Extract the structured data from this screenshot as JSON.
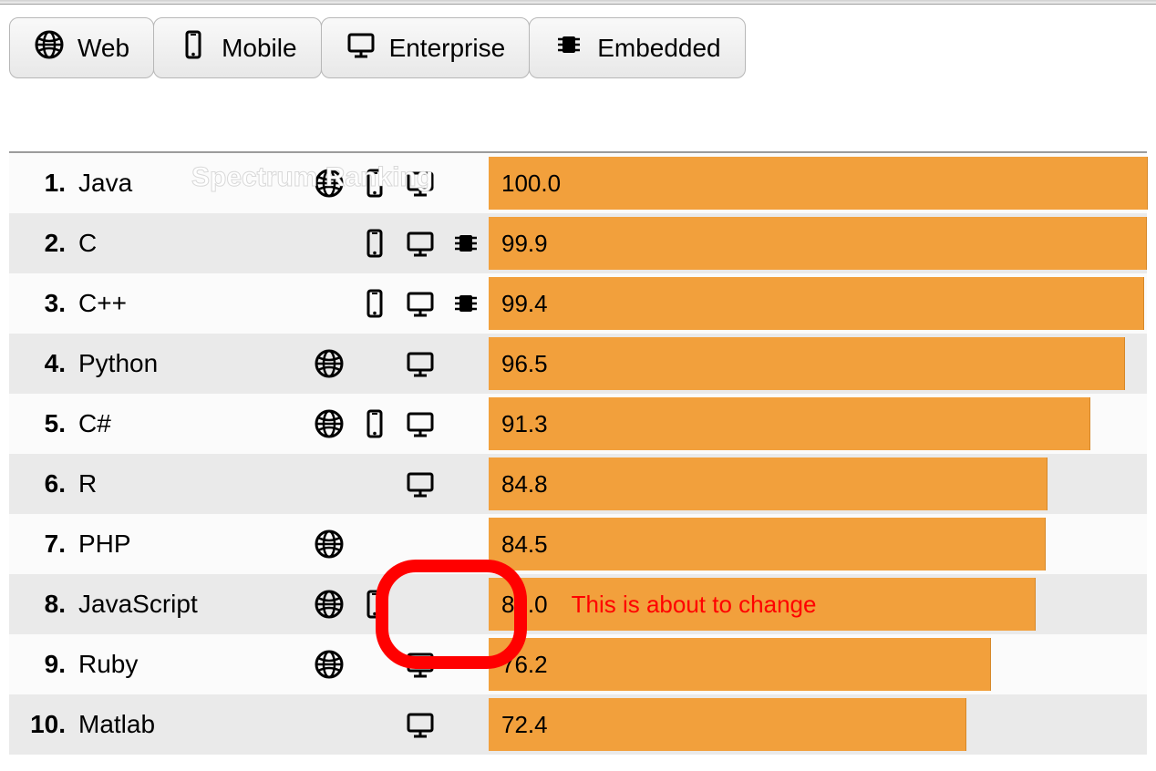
{
  "tabs": [
    {
      "label": "Web",
      "icon": "globe"
    },
    {
      "label": "Mobile",
      "icon": "mobile"
    },
    {
      "label": "Enterprise",
      "icon": "desktop"
    },
    {
      "label": "Embedded",
      "icon": "chip"
    }
  ],
  "header_ghost": "Spectrum Ranking",
  "annotation": {
    "row_index": 7,
    "note": "This is about to change"
  },
  "colors": {
    "bar": "#f2a03c",
    "annotation": "#ff0000"
  },
  "chart_data": {
    "type": "bar",
    "title": "Spectrum Ranking",
    "xlabel": "",
    "ylabel": "",
    "ylim": [
      0,
      100
    ],
    "categories": [
      "Java",
      "C",
      "C++",
      "Python",
      "C#",
      "R",
      "PHP",
      "JavaScript",
      "Ruby",
      "Matlab"
    ],
    "values": [
      100.0,
      99.9,
      99.4,
      96.5,
      91.3,
      84.8,
      84.5,
      83.0,
      76.2,
      72.4
    ],
    "rows": [
      {
        "rank": "1.",
        "name": "Java",
        "score": "100.0",
        "web": true,
        "mobile": true,
        "enterprise": true,
        "embedded": false
      },
      {
        "rank": "2.",
        "name": "C",
        "score": "99.9",
        "web": false,
        "mobile": true,
        "enterprise": true,
        "embedded": true
      },
      {
        "rank": "3.",
        "name": "C++",
        "score": "99.4",
        "web": false,
        "mobile": true,
        "enterprise": true,
        "embedded": true
      },
      {
        "rank": "4.",
        "name": "Python",
        "score": "96.5",
        "web": true,
        "mobile": false,
        "enterprise": true,
        "embedded": false
      },
      {
        "rank": "5.",
        "name": "C#",
        "score": "91.3",
        "web": true,
        "mobile": true,
        "enterprise": true,
        "embedded": false
      },
      {
        "rank": "6.",
        "name": "R",
        "score": "84.8",
        "web": false,
        "mobile": false,
        "enterprise": true,
        "embedded": false
      },
      {
        "rank": "7.",
        "name": "PHP",
        "score": "84.5",
        "web": true,
        "mobile": false,
        "enterprise": false,
        "embedded": false
      },
      {
        "rank": "8.",
        "name": "JavaScript",
        "score": "83.0",
        "web": true,
        "mobile": true,
        "enterprise": false,
        "embedded": false
      },
      {
        "rank": "9.",
        "name": "Ruby",
        "score": "76.2",
        "web": true,
        "mobile": false,
        "enterprise": true,
        "embedded": false
      },
      {
        "rank": "10.",
        "name": "Matlab",
        "score": "72.4",
        "web": false,
        "mobile": false,
        "enterprise": true,
        "embedded": false
      }
    ]
  }
}
